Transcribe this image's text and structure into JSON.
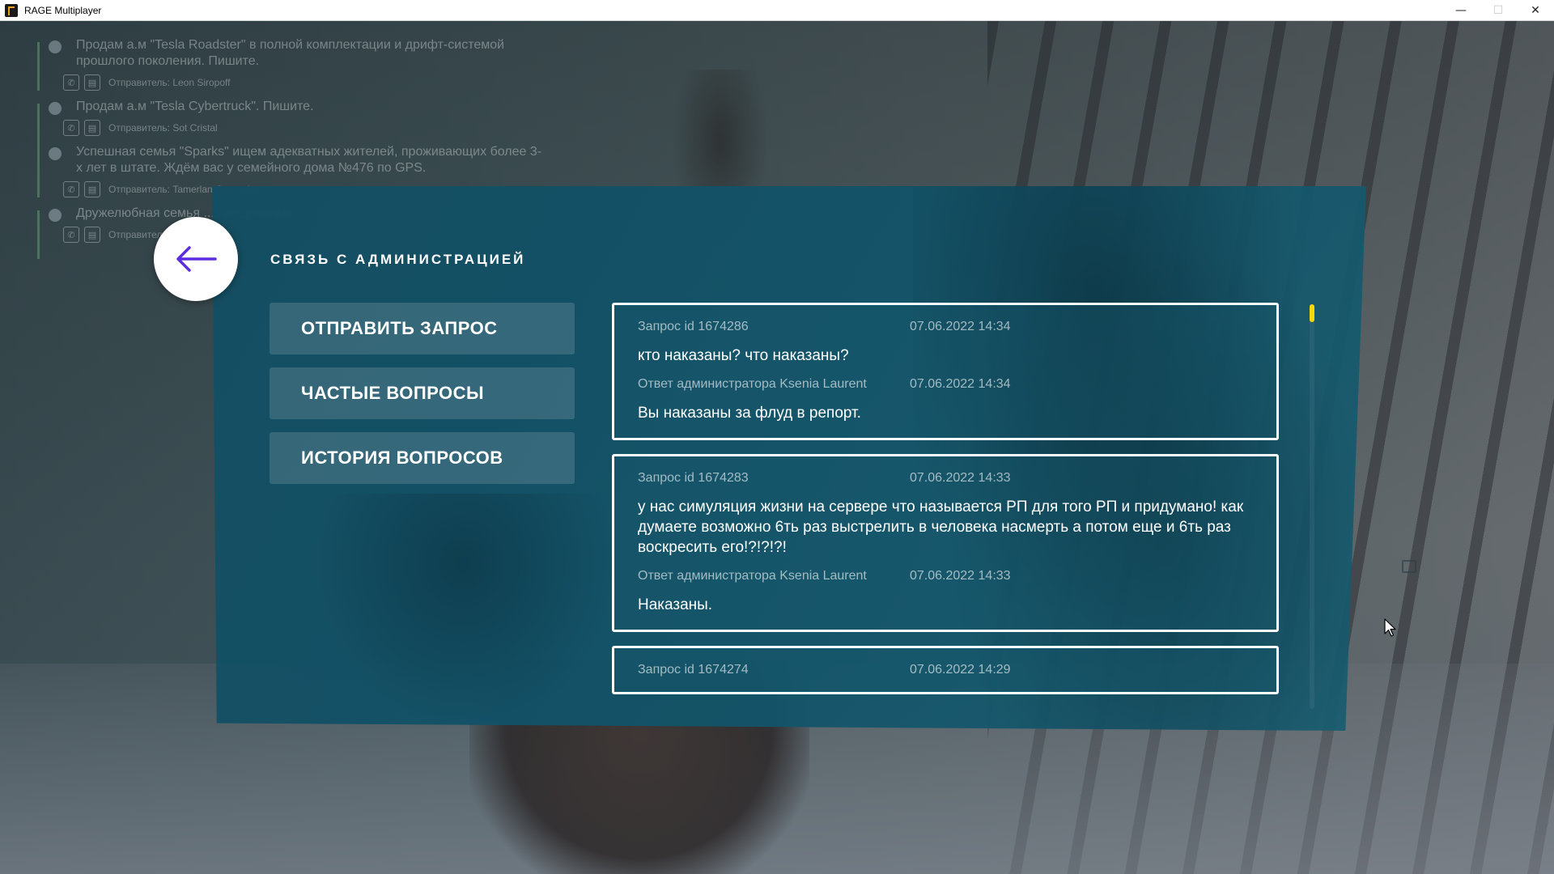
{
  "window": {
    "title": "RAGE Multiplayer",
    "minimize_glyph": "—",
    "maximize_glyph": "☐",
    "close_glyph": "✕"
  },
  "feed": {
    "items": [
      {
        "text": "Продам а.м \"Tesla Roadster\" в полной комплектации и дрифт-системой прошлого поколения. Пишите.",
        "sender": "Отправитель: Leon Siropoff"
      },
      {
        "text": "Продам а.м \"Tesla Cybertruck\". Пишите.",
        "sender": "Отправитель: Sot Cristal"
      },
      {
        "text": "Успешная семья \"Sparks\" ищем адекватных жителей, проживающих более 3-х лет в штате. Ждём вас у семейного дома №476 по GPS.",
        "sender": "Отправитель: Tamerlan Generalov"
      },
      {
        "text": "Дружелюбная семья ... ежедневных ...",
        "sender": "Отправитель: ..."
      }
    ]
  },
  "panel": {
    "title": "СВЯЗЬ С АДМИНИСТРАЦИЕЙ",
    "menu": [
      {
        "label": "ОТПРАВИТЬ ЗАПРОС"
      },
      {
        "label": "ЧАСТЫЕ ВОПРОСЫ"
      },
      {
        "label": "ИСТОРИЯ ВОПРОСОВ"
      }
    ],
    "requests": [
      {
        "id_label": "Запрос id 1674286",
        "date": "07.06.2022 14:34",
        "message": "кто наказаны? что наказаны?",
        "answer_label": "Ответ администратора Ksenia Laurent",
        "answer_date": "07.06.2022 14:34",
        "answer": "Вы наказаны за флуд в репорт."
      },
      {
        "id_label": "Запрос id 1674283",
        "date": "07.06.2022 14:33",
        "message": "у нас симуляция жизни на сервере что называется РП для того РП и придумано! как думаете возможно 6ть раз выстрелить в человека насмерть а потом еще и 6ть раз воскресить его!?!?!?!",
        "answer_label": "Ответ администратора Ksenia Laurent",
        "answer_date": "07.06.2022 14:33",
        "answer": "Наказаны."
      },
      {
        "id_label": "Запрос id 1674274",
        "date": "07.06.2022 14:29"
      }
    ]
  },
  "colors": {
    "panel_bg": "#145468",
    "accent_scroll": "#f5d90a",
    "back_arrow": "#5b2ee0",
    "feed_bar": "#6ec97b"
  },
  "icons": {
    "back": "arrow-left-icon",
    "phone": "phone-icon",
    "chat": "chat-icon",
    "cursor": "mouse-cursor-icon",
    "lock": "lock-icon"
  }
}
